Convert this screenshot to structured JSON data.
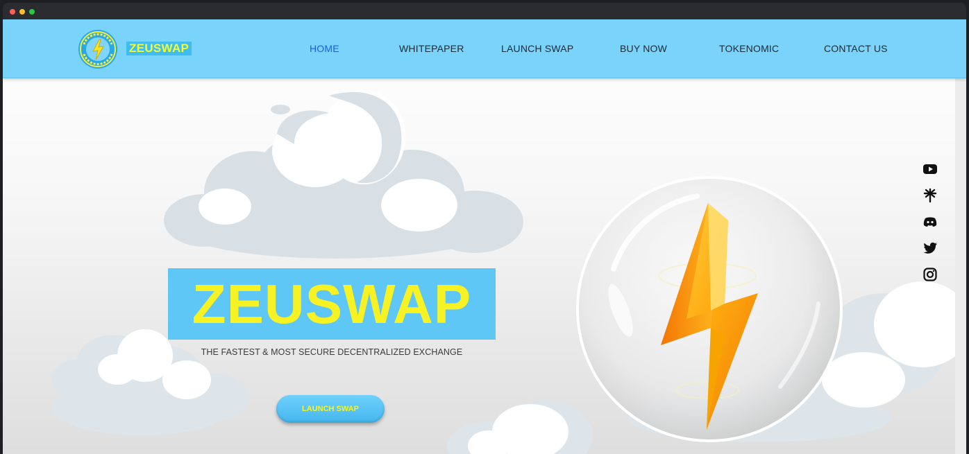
{
  "window": {
    "controls": [
      "close",
      "minimize",
      "maximize"
    ],
    "colors": {
      "close": "#ff5f57",
      "minimize": "#febc2e",
      "maximize": "#28c840"
    }
  },
  "nav": {
    "brand": "ZEUSWAP",
    "logo_text": "ZEUSWAP",
    "links": [
      {
        "label": "HOME",
        "active": true
      },
      {
        "label": "WHITEPAPER",
        "active": false
      },
      {
        "label": "LAUNCH SWAP",
        "active": false
      },
      {
        "label": "BUY NOW",
        "active": false
      },
      {
        "label": "TOKENOMIC",
        "active": false
      },
      {
        "label": "CONTACT US",
        "active": false
      }
    ]
  },
  "hero": {
    "title": "ZEUSWAP",
    "subtitle": "THE FASTEST & MOST SECURE DECENTRALIZED EXCHANGE",
    "cta_label": "LAUNCH SWAP",
    "illustration": "lightning-bolt-in-bubble"
  },
  "social": [
    "youtube-icon",
    "linktree-icon",
    "discord-icon",
    "twitter-icon",
    "instagram-icon"
  ],
  "colors": {
    "nav_bg": "#79d3fb",
    "brand_bg": "#3fbcf2",
    "title_bg": "#5ec7f6",
    "title_text": "#f7f224",
    "active_link": "#1e5ed8"
  }
}
